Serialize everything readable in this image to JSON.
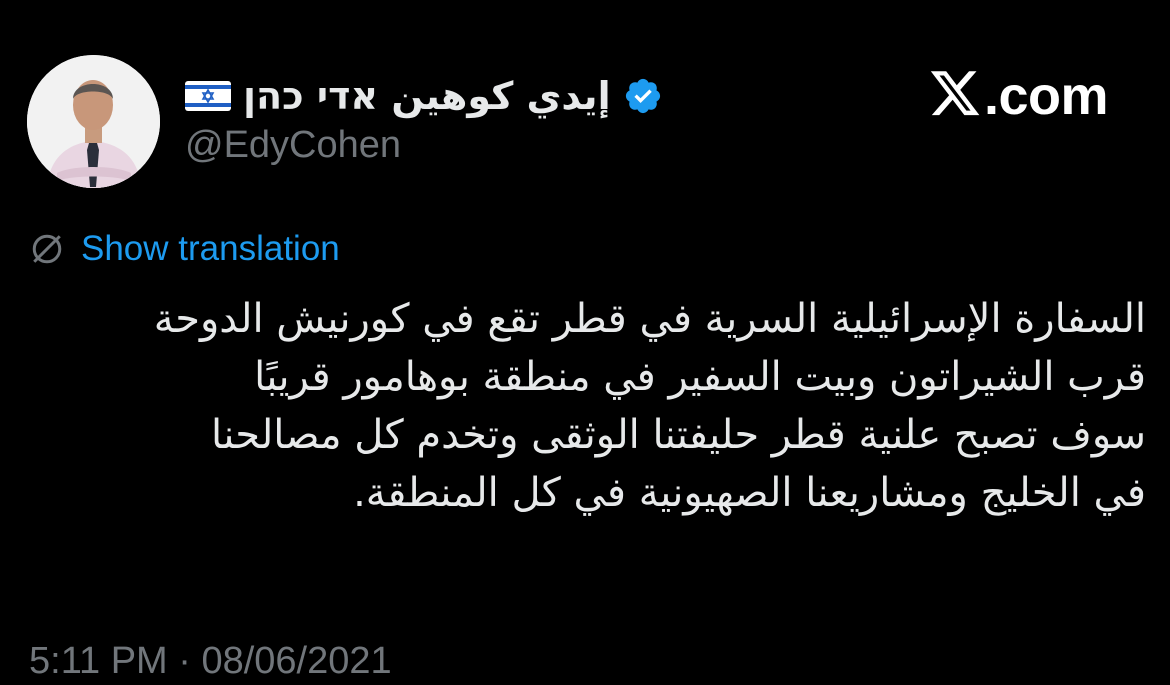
{
  "author": {
    "display_name": "إيدي كوهين אדי כהן",
    "handle": "@EdyCohen",
    "flag_icon": "israel-flag-icon",
    "verified_icon": "verified-badge-icon",
    "verified_color": "#1d9bf0"
  },
  "brand": {
    "logo_icon": "x-logo-icon",
    "text": ".com"
  },
  "translation": {
    "icon": "globe-slash-icon",
    "label": "Show translation",
    "color": "#1d9bf0"
  },
  "tweet": {
    "lines": [
      "السفارة الإسرائيلية السرية في قطر تقع في كورنيش الدوحة",
      "قرب الشيراتون وبيت السفير في منطقة بوهامور قريبًا",
      "سوف تصبح علنية قطر حليفتنا الوثقى وتخدم كل مصالحنا",
      "في الخليج ومشاريعنا الصهيونية في كل المنطقة."
    ]
  },
  "timestamp": "5:11 PM · 08/06/2021",
  "colors": {
    "background": "#000000",
    "text_primary": "#e7e9ea",
    "text_secondary": "#71767b"
  }
}
